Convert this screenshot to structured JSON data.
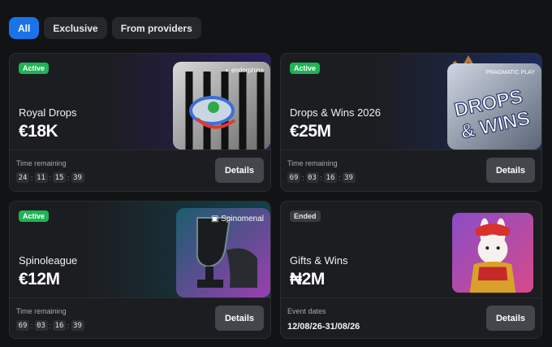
{
  "tabs": [
    {
      "label": "All",
      "active": true
    },
    {
      "label": "Exclusive",
      "active": false
    },
    {
      "label": "From providers",
      "active": false
    }
  ],
  "cards": [
    {
      "status": "Active",
      "name": "Royal Drops",
      "amount": "€18K",
      "provider": "endorphina",
      "info_label": "Time remaining",
      "timer": [
        "24",
        "11",
        "15",
        "39"
      ],
      "button": "Details",
      "theme": "#2a1d5c"
    },
    {
      "status": "Active",
      "name": "Drops & Wins 2026",
      "amount": "€25M",
      "provider": "PRAGMATIC PLAY",
      "info_label": "Time remaining",
      "timer": [
        "69",
        "03",
        "16",
        "39"
      ],
      "button": "Details",
      "theme": "#1c2a5c",
      "art_text": [
        "DROPS",
        "& WINS"
      ]
    },
    {
      "status": "Active",
      "name": "Spinoleague",
      "amount": "€12M",
      "provider": "Spinomenal",
      "info_label": "Time remaining",
      "timer": [
        "69",
        "03",
        "16",
        "39"
      ],
      "button": "Details",
      "theme": "#13404c"
    },
    {
      "status": "Ended",
      "name": "Gifts & Wins",
      "amount": "₦2M",
      "info_label": "Event dates",
      "dates": "12/08/26-31/08/26",
      "button": "Details",
      "theme": "#26272b"
    }
  ],
  "colors": {
    "accent": "#1a73e8",
    "active_badge": "#1fb455"
  }
}
